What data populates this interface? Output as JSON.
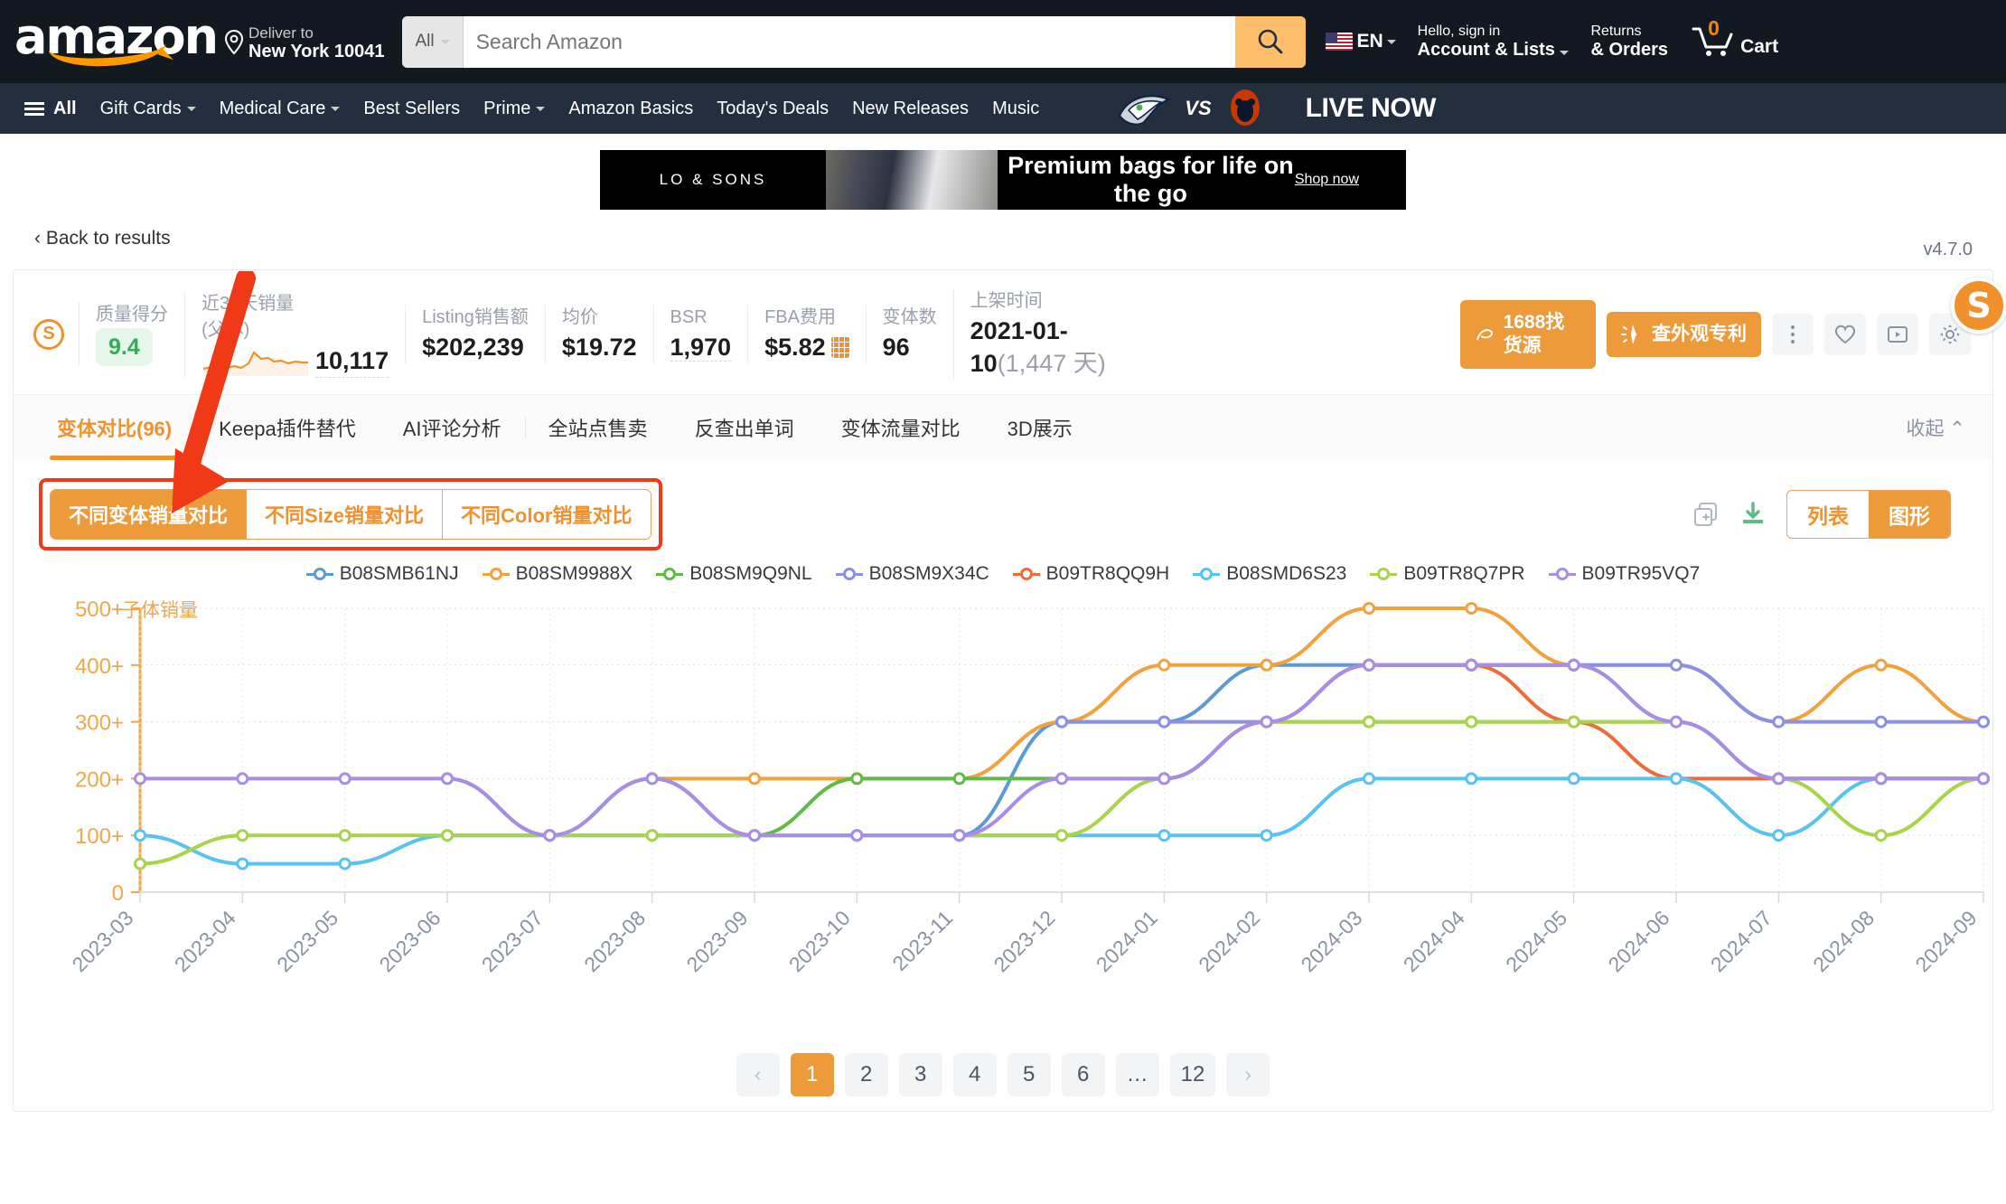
{
  "amazon": {
    "logo_word": "amazon",
    "deliver_sub": "Deliver to",
    "deliver_main": "New York 10041",
    "search_category": "All",
    "search_placeholder": "Search Amazon",
    "search_value": "",
    "lang": "EN",
    "account_l1": "Hello, sign in",
    "account_l2": "Account & Lists",
    "returns_l1": "Returns",
    "returns_l2": "& Orders",
    "cart_label": "Cart",
    "cart_count": "0",
    "nav": [
      "All",
      "Gift Cards",
      "Medical Care",
      "Best Sellers",
      "Prime",
      "Amazon Basics",
      "Today's Deals",
      "New Releases",
      "Music"
    ],
    "live_now": "LIVE NOW",
    "vs": "VS"
  },
  "ad": {
    "brand": "LO & SONS",
    "copy": "Premium bags for life on the go",
    "shop": "Shop now"
  },
  "back_link": "Back to results",
  "panel": {
    "version": "v4.7.0",
    "logo_letter": "S",
    "metrics": [
      {
        "label": "质量得分",
        "value": "9.4",
        "type": "score"
      },
      {
        "label": "近30天销量(父体)",
        "value": "10,117",
        "type": "spark"
      },
      {
        "label": "Listing销售额",
        "value": "$202,239",
        "type": "plain"
      },
      {
        "label": "均价",
        "value": "$19.72",
        "type": "plain"
      },
      {
        "label": "BSR",
        "value": "1,970",
        "type": "dotted"
      },
      {
        "label": "FBA费用",
        "value": "$5.82",
        "type": "calc"
      },
      {
        "label": "变体数",
        "value": "96",
        "type": "plain"
      },
      {
        "label": "上架时间",
        "value": "2021-01-10",
        "sub": "(1,447 天)",
        "type": "date"
      }
    ],
    "actions": {
      "btn1": "1688找货源",
      "btn2": "查外观专利",
      "more_icon": "more-vertical-icon",
      "fav_icon": "heart-icon",
      "video_icon": "play-icon",
      "settings_icon": "gear-icon"
    }
  },
  "tabs": {
    "items": [
      {
        "label": "变体对比(96)",
        "active": true
      },
      {
        "label": "Keepa插件替代",
        "active": false
      },
      {
        "label": "AI评论分析",
        "active": false
      },
      {
        "label": "全站点售卖",
        "active": false,
        "sep": true
      },
      {
        "label": "反查出单词",
        "active": false
      },
      {
        "label": "变体流量对比",
        "active": false
      },
      {
        "label": "3D展示",
        "active": false
      }
    ],
    "collapse": "收起"
  },
  "segment": {
    "options": [
      {
        "label": "不同变体销量对比",
        "selected": true
      },
      {
        "label": "不同Size销量对比",
        "selected": false
      },
      {
        "label": "不同Color销量对比",
        "selected": false
      }
    ]
  },
  "view_toggle": {
    "copy_icon": "copy-add-icon",
    "download_icon": "download-icon",
    "options": [
      {
        "label": "列表",
        "selected": false
      },
      {
        "label": "图形",
        "selected": true
      }
    ]
  },
  "pagination": {
    "prev_icon": "chevron-left-icon",
    "next_icon": "chevron-right-icon",
    "pages": [
      "1",
      "2",
      "3",
      "4",
      "5",
      "6",
      "…",
      "12"
    ],
    "current": "1"
  },
  "chart_data": {
    "type": "line",
    "title": "子体销量",
    "xlabel": "",
    "ylabel": "子体销量",
    "grid": true,
    "legend_position": "top-center",
    "ylim": [
      0,
      500
    ],
    "ytick_labels": [
      "0",
      "100+",
      "200+",
      "300+",
      "400+",
      "500+"
    ],
    "ytick_values": [
      0,
      100,
      200,
      300,
      400,
      500
    ],
    "categories": [
      "2023-03",
      "2023-04",
      "2023-05",
      "2023-06",
      "2023-07",
      "2023-08",
      "2023-09",
      "2023-10",
      "2023-11",
      "2023-12",
      "2024-01",
      "2024-02",
      "2024-03",
      "2024-04",
      "2024-05",
      "2024-06",
      "2024-07",
      "2024-08",
      "2024-09"
    ],
    "series": [
      {
        "name": "B08SMB61NJ",
        "color": "#5B9BD5",
        "values": [
          null,
          null,
          null,
          null,
          null,
          null,
          null,
          100,
          100,
          300,
          300,
          400,
          400,
          400,
          400,
          300,
          200,
          200,
          200
        ]
      },
      {
        "name": "B08SM9988X",
        "color": "#F2A13C",
        "values": [
          null,
          null,
          null,
          null,
          null,
          200,
          200,
          200,
          200,
          300,
          400,
          400,
          500,
          500,
          400,
          400,
          300,
          400,
          300
        ]
      },
      {
        "name": "B08SM9Q9NL",
        "color": "#5FBB46",
        "values": [
          null,
          null,
          null,
          200,
          100,
          200,
          100,
          200,
          200,
          200,
          200,
          300,
          300,
          300,
          300,
          300,
          200,
          200,
          200
        ]
      },
      {
        "name": "B08SM9X34C",
        "color": "#8B8FE8",
        "values": [
          null,
          null,
          null,
          null,
          null,
          null,
          null,
          null,
          null,
          300,
          300,
          300,
          400,
          400,
          400,
          400,
          300,
          300,
          300
        ]
      },
      {
        "name": "B09TR8QQ9H",
        "color": "#ED6B3B",
        "values": [
          null,
          null,
          null,
          null,
          null,
          null,
          null,
          null,
          null,
          null,
          200,
          300,
          400,
          400,
          300,
          200,
          200,
          200,
          200
        ]
      },
      {
        "name": "B08SMD6S23",
        "color": "#56C3F0",
        "values": [
          100,
          50,
          50,
          100,
          100,
          100,
          100,
          100,
          100,
          100,
          100,
          100,
          200,
          200,
          200,
          200,
          100,
          200,
          200
        ]
      },
      {
        "name": "B09TR8Q7PR",
        "color": "#A8D34A",
        "values": [
          50,
          100,
          100,
          100,
          100,
          100,
          100,
          100,
          100,
          100,
          200,
          300,
          300,
          300,
          300,
          300,
          200,
          100,
          200
        ]
      },
      {
        "name": "B09TR95VQ7",
        "color": "#A98BE8",
        "values": [
          200,
          200,
          200,
          200,
          100,
          200,
          100,
          100,
          100,
          200,
          200,
          300,
          400,
          400,
          400,
          300,
          200,
          200,
          200
        ]
      }
    ]
  }
}
